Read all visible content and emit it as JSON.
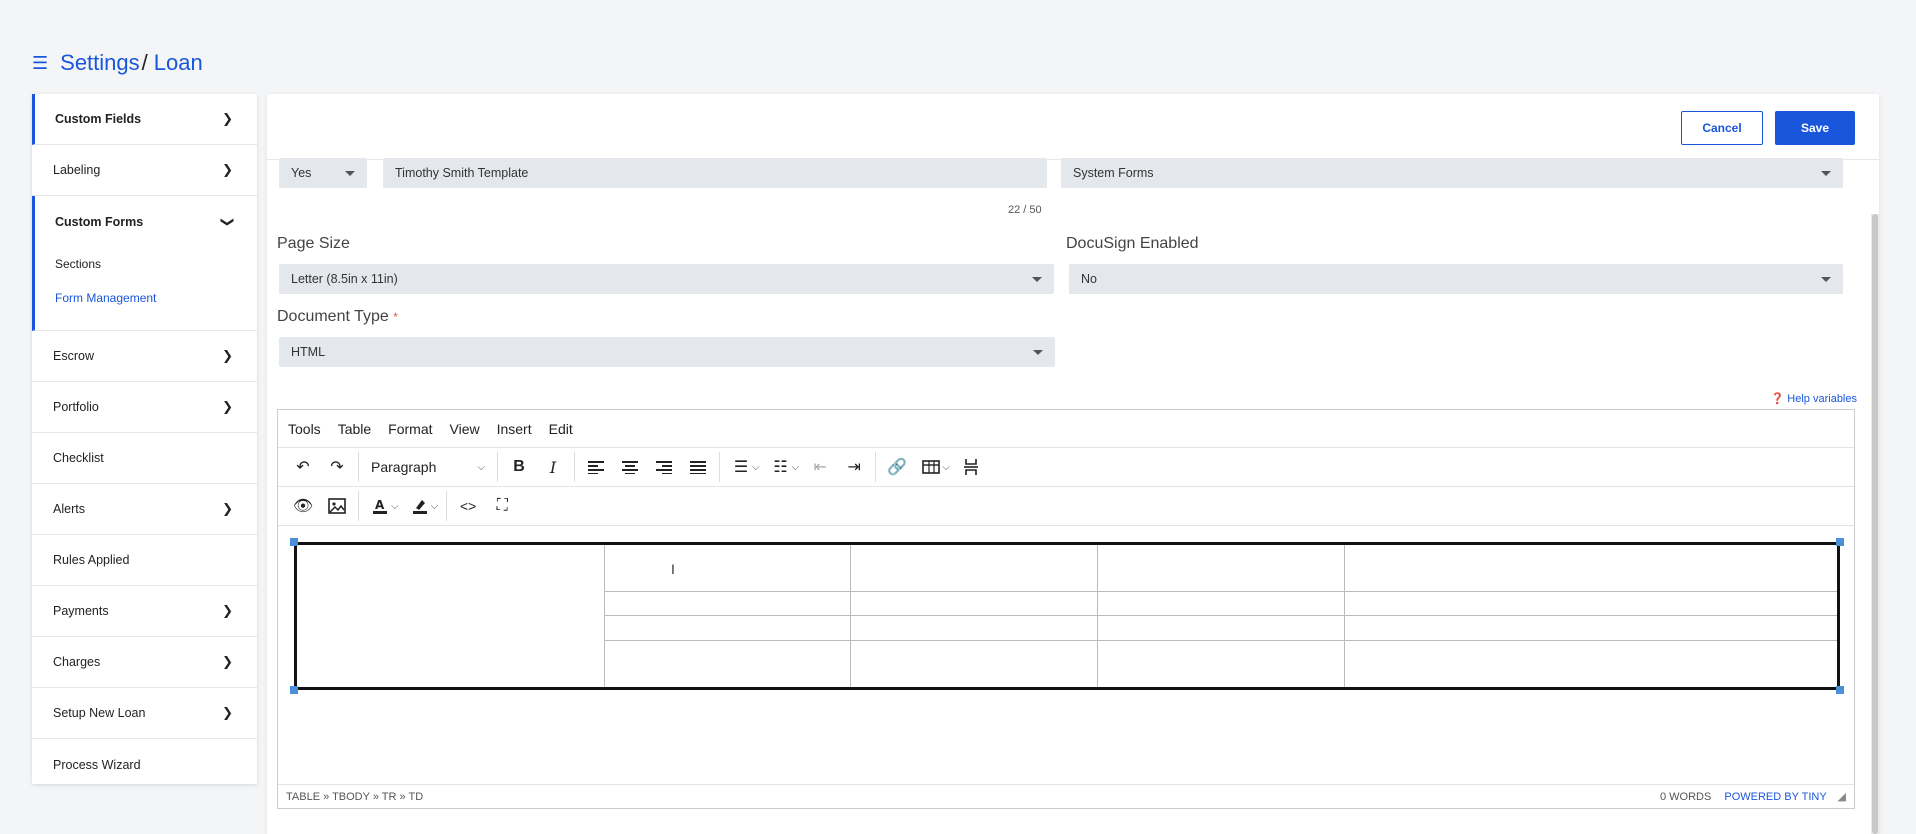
{
  "breadcrumb": {
    "menu_icon": "hamburger-icon",
    "root": "Settings",
    "separator": "/",
    "current": "Loan"
  },
  "sidebar": {
    "items": [
      {
        "label": "Custom Fields"
      },
      {
        "label": "Labeling"
      },
      {
        "label": "Custom Forms",
        "sub": [
          "Sections",
          "Form Management"
        ]
      },
      {
        "label": "Escrow"
      },
      {
        "label": "Portfolio"
      },
      {
        "label": "Checklist"
      },
      {
        "label": "Alerts"
      },
      {
        "label": "Rules Applied"
      },
      {
        "label": "Payments"
      },
      {
        "label": "Charges"
      },
      {
        "label": "Setup New Loan"
      },
      {
        "label": "Process Wizard"
      }
    ]
  },
  "actions": {
    "cancel": "Cancel",
    "save": "Save"
  },
  "form": {
    "active_value": "Yes",
    "template_name": "Timothy Smith Template",
    "char_counter": "22 / 50",
    "form_group": "System Forms",
    "page_size_label": "Page Size",
    "page_size_value": "Letter (8.5in x 11in)",
    "docusign_label": "DocuSign Enabled",
    "docusign_value": "No",
    "doc_type_label": "Document Type",
    "doc_type_required": "*",
    "doc_type_value": "HTML",
    "help_variables": "Help variables"
  },
  "editor": {
    "menus": [
      "Tools",
      "Table",
      "Format",
      "View",
      "Insert",
      "Edit"
    ],
    "block_format": "Paragraph",
    "path": "TABLE » TBODY » TR » TD",
    "word_count": "0 WORDS",
    "powered_by": "POWERED BY TINY"
  }
}
